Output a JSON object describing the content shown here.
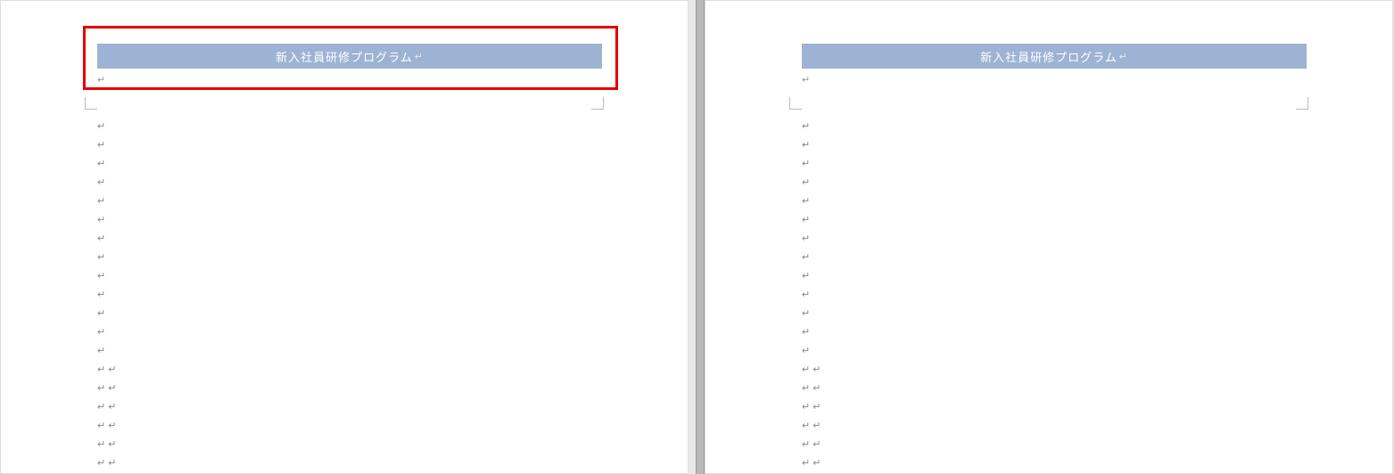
{
  "document": {
    "header_title": "新入社員研修プログラム",
    "pilcrow": "↵",
    "paragraph_mark": "↵",
    "colors": {
      "header_band": "#9db3d4",
      "highlight_border": "#e60000"
    },
    "pages": [
      {
        "has_highlight": true,
        "para_lines": 19,
        "double_mark_start_index": 13
      },
      {
        "has_highlight": false,
        "para_lines": 19,
        "double_mark_start_index": 13
      }
    ]
  }
}
